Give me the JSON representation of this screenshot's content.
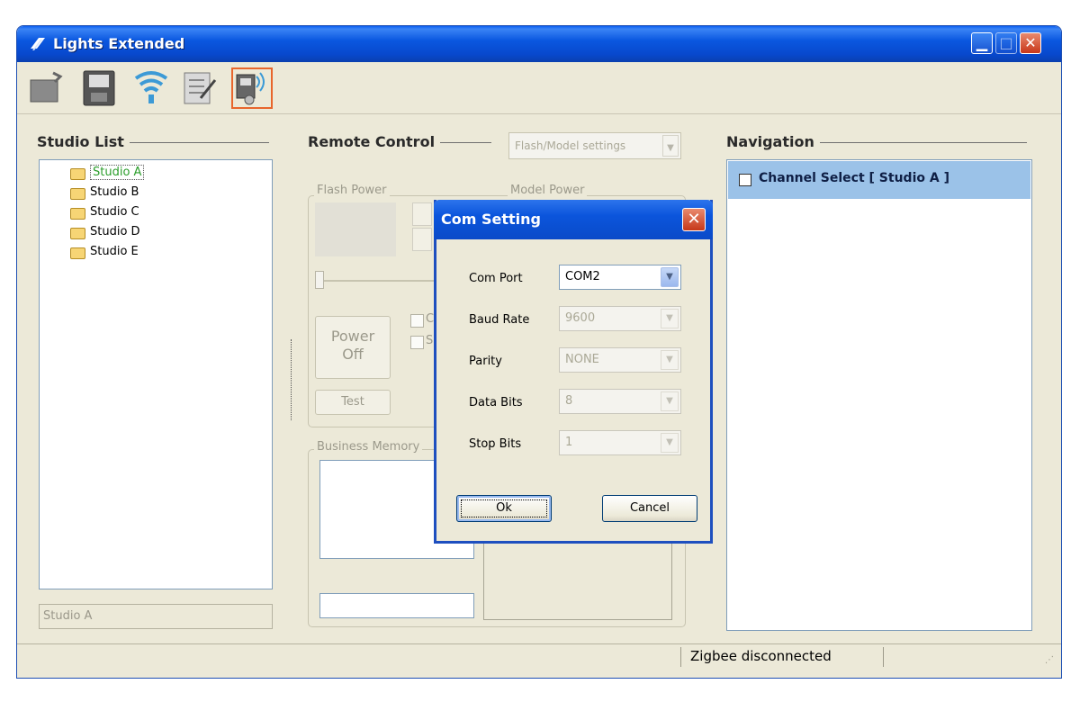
{
  "window": {
    "title": "Lights Extended"
  },
  "toolbar": {
    "buttons": [
      {
        "icon": "open-folder-icon"
      },
      {
        "icon": "save-disk-icon"
      },
      {
        "icon": "wireless-signal-icon"
      },
      {
        "icon": "notepad-edit-icon"
      },
      {
        "icon": "com-port-settings-icon",
        "active": true
      }
    ]
  },
  "studio_list": {
    "heading": "Studio List",
    "items": [
      {
        "label": "Studio A",
        "selected": true
      },
      {
        "label": "Studio B"
      },
      {
        "label": "Studio C"
      },
      {
        "label": "Studio D"
      },
      {
        "label": "Studio E"
      }
    ],
    "current_value": "Studio A"
  },
  "remote_control": {
    "heading": "Remote Control",
    "mode_select": "Flash/Model settings",
    "flash_power_label": "Flash Power",
    "model_power_label": "Model Power",
    "power_button_line1": "Power",
    "power_button_line2": "Off",
    "test_button": "Test",
    "check1_label": "C",
    "check2_label": "S",
    "business_memory_label": "Business Memory"
  },
  "navigation": {
    "heading": "Navigation",
    "row_label": "Channel Select [ Studio A ]"
  },
  "status_bar": {
    "text": "Zigbee disconnected"
  },
  "dialog": {
    "title": "Com Setting",
    "close_glyph": "✕",
    "fields": {
      "com_port_label": "Com Port",
      "com_port_value": "COM2",
      "baud_rate_label": "Baud Rate",
      "baud_rate_value": "9600",
      "parity_label": "Parity",
      "parity_value": "NONE",
      "data_bits_label": "Data Bits",
      "data_bits_value": "8",
      "stop_bits_label": "Stop Bits",
      "stop_bits_value": "1"
    },
    "ok_label": "Ok",
    "cancel_label": "Cancel"
  },
  "colors": {
    "titlebar_blue": "#0a57e0",
    "active_toolbar_border": "#e8662c",
    "nav_selection": "#9bc2e8",
    "selected_tree_text": "#2a9d2a"
  }
}
